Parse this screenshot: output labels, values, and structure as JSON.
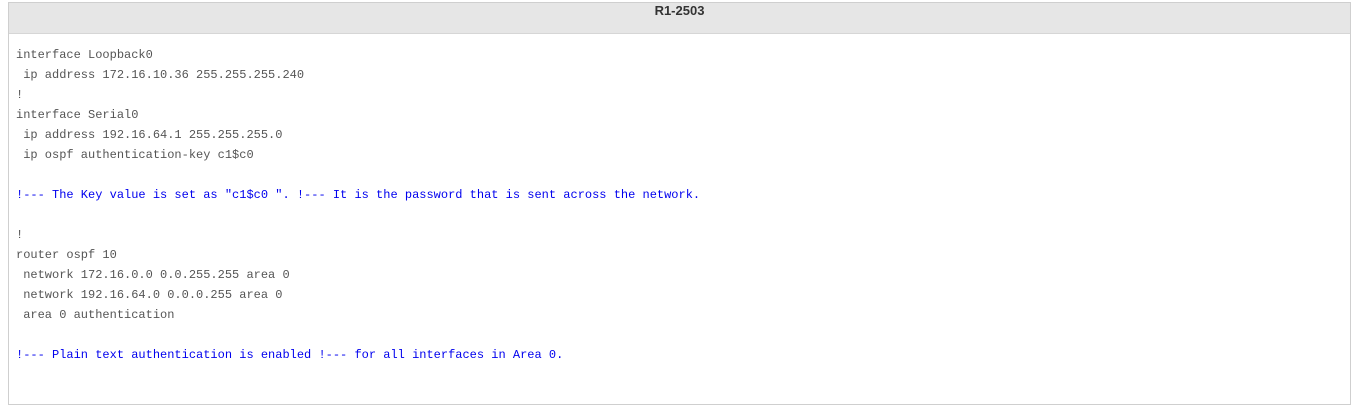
{
  "title": "R1-2503",
  "lines": [
    {
      "text": "interface Loopback0",
      "type": "code"
    },
    {
      "text": " ip address 172.16.10.36 255.255.255.240",
      "type": "code"
    },
    {
      "text": "!",
      "type": "code"
    },
    {
      "text": "interface Serial0",
      "type": "code"
    },
    {
      "text": " ip address 192.16.64.1 255.255.255.0",
      "type": "code"
    },
    {
      "text": " ip ospf authentication-key c1$c0",
      "type": "code"
    },
    {
      "text": "",
      "type": "code"
    },
    {
      "text": "!--- The Key value is set as \"c1$c0 \". !--- It is the password that is sent across the network.",
      "type": "comment"
    },
    {
      "text": "",
      "type": "code"
    },
    {
      "text": "!",
      "type": "code"
    },
    {
      "text": "router ospf 10",
      "type": "code"
    },
    {
      "text": " network 172.16.0.0 0.0.255.255 area 0",
      "type": "code"
    },
    {
      "text": " network 192.16.64.0 0.0.0.255 area 0",
      "type": "code"
    },
    {
      "text": " area 0 authentication",
      "type": "code"
    },
    {
      "text": "",
      "type": "code"
    },
    {
      "text": "!--- Plain text authentication is enabled !--- for all interfaces in Area 0.",
      "type": "comment"
    }
  ],
  "colors": {
    "code": "#555555",
    "comment": "#0000ee",
    "header_bg": "#e6e6e6"
  }
}
